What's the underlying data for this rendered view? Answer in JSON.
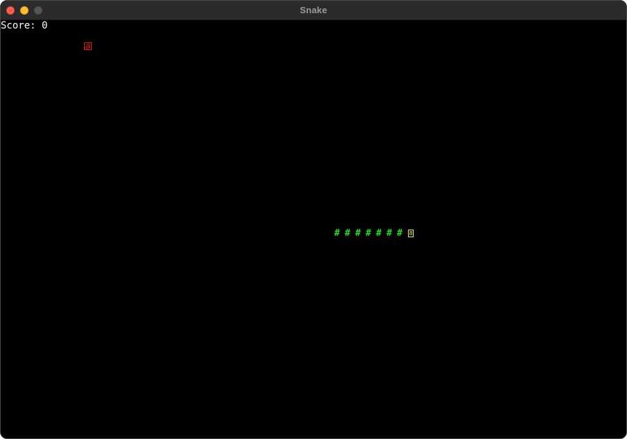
{
  "window": {
    "title": "Snake"
  },
  "hud": {
    "score_label": "Score:",
    "score_value": "0"
  },
  "game": {
    "food_glyph": "@",
    "snake_body_glyph": "#",
    "snake_body_segments": 7,
    "snake_head_glyph": "8"
  },
  "colors": {
    "background": "#000000",
    "score_text": "#ffffff",
    "food": "#e01818",
    "snake_body": "#22e022",
    "snake_head": "#f2e84a"
  }
}
